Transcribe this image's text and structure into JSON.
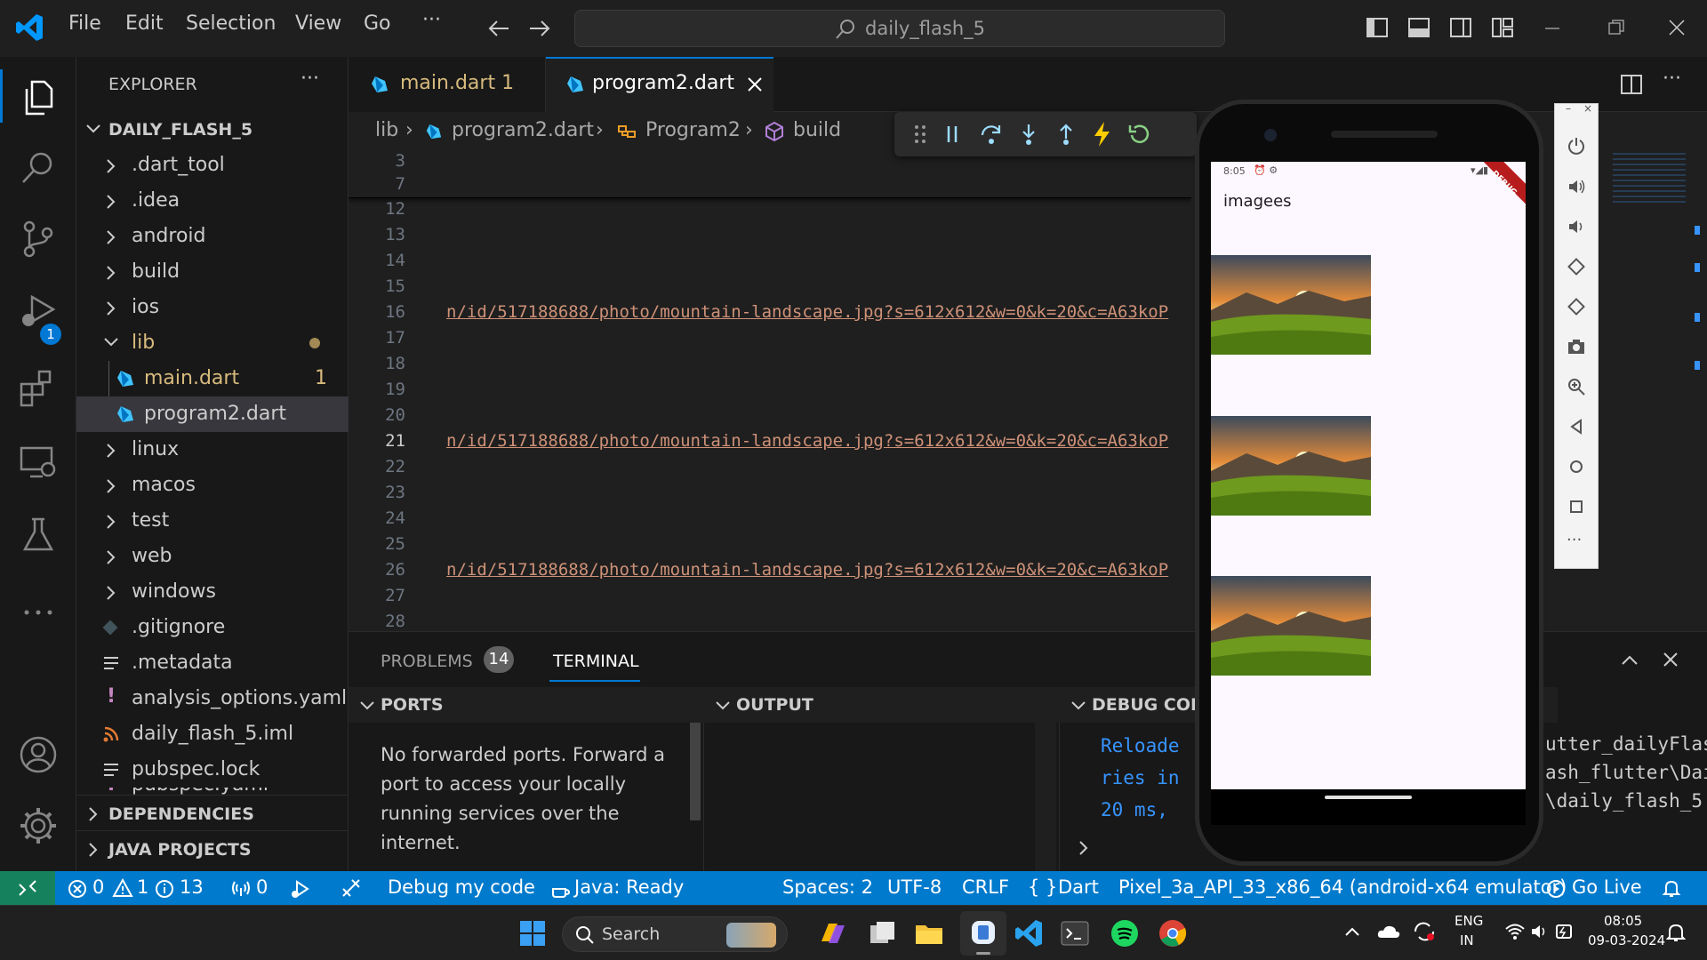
{
  "menu": [
    "File",
    "Edit",
    "Selection",
    "View",
    "Go",
    "···"
  ],
  "search": {
    "text": "daily_flash_5"
  },
  "explorer": {
    "title": "EXPLORER",
    "more": "···",
    "project": "DAILY_FLASH_5",
    "items": [
      ".dart_tool",
      ".idea",
      "android",
      "build",
      "ios",
      "lib",
      "main.dart",
      "program2.dart",
      "linux",
      "macos",
      "test",
      "web",
      "windows",
      ".gitignore",
      ".metadata",
      "analysis_options.yaml",
      "daily_flash_5.iml",
      "pubspec.lock",
      "pubspec.yaml"
    ],
    "main_badge": "1",
    "sections": [
      "DEPENDENCIES",
      "JAVA PROJECTS"
    ]
  },
  "activity": {
    "debug_badge": "1"
  },
  "tabs": [
    {
      "label": "main.dart 1",
      "color": "#d7ba7d"
    },
    {
      "label": "program2.dart",
      "color": "#ffffff"
    }
  ],
  "breadcrumbs": [
    "lib",
    "program2.dart",
    "Program2",
    "build"
  ],
  "code": {
    "line_numbers": [
      "3",
      "7",
      "12",
      "13",
      "14",
      "15",
      "16",
      "17",
      "18",
      "19",
      "20",
      "21",
      "22",
      "23",
      "24",
      "25",
      "26",
      "27",
      "28"
    ],
    "current_line": "21",
    "url_text": "n/id/517188688/photo/mountain-landscape.jpg?s=612x612&w=0&k=20&c=A63koP"
  },
  "panel": {
    "tabs": [
      "PROBLEMS",
      "TERMINAL"
    ],
    "problems_count": "14",
    "ports_title": "PORTS",
    "ports_message": "No forwarded ports. Forward a port to access your locally running services over the internet.",
    "output_title": "OUTPUT",
    "debug_title": "DEBUG CON",
    "debug_lines": [
      "Reloade",
      "ries in",
      "20 ms,"
    ],
    "terminal_lines": [
      "utter_dailyFlas",
      "ash_flutter\\Dai",
      "\\daily_flash_5"
    ]
  },
  "statusbar": {
    "errors": "0",
    "warnings": "1",
    "infos": "13",
    "ports": "0",
    "debug": "Debug my code",
    "java": "Java: Ready",
    "spaces": "Spaces: 2",
    "encoding": "UTF-8",
    "eol": "CRLF",
    "language": "Dart",
    "device": "Pixel_3a_API_33_x86_64 (android-x64 emulator)",
    "golive": "Go Live"
  },
  "emulator": {
    "time": "8:05",
    "app_title": "imagees",
    "banner": "DEBUG"
  },
  "taskbar": {
    "search": "Search",
    "lang1": "ENG",
    "lang2": "IN",
    "time": "08:05",
    "date": "09-03-2024"
  },
  "colors": {
    "accent": "#007acc",
    "dart": "#40c4ff",
    "folder_modified": "#d7ba7d"
  }
}
